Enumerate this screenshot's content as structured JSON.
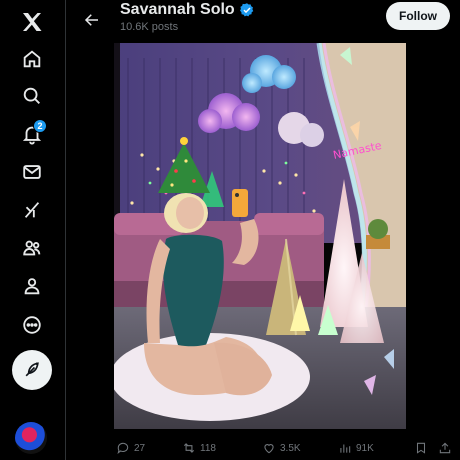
{
  "nav": {
    "items": [
      {
        "name": "x-logo-icon"
      },
      {
        "name": "home-icon"
      },
      {
        "name": "search-icon"
      },
      {
        "name": "notifications-icon",
        "badge": "2"
      },
      {
        "name": "messages-icon"
      },
      {
        "name": "grok-icon"
      },
      {
        "name": "communities-icon"
      },
      {
        "name": "profile-icon"
      },
      {
        "name": "more-icon"
      }
    ],
    "compose_icon": "feather-icon"
  },
  "header": {
    "name": "Savannah Solo",
    "posts": "10.6K posts",
    "follow_label": "Follow"
  },
  "media": {
    "alt_description": "photo"
  },
  "actions": {
    "replies": "27",
    "reposts": "118",
    "likes": "3.5K",
    "views": "91K"
  },
  "colors": {
    "background": "#000000",
    "text": "#e7e9ea",
    "muted": "#71767b",
    "accent": "#1d9bf0",
    "follow_bg": "#eff3f4"
  }
}
